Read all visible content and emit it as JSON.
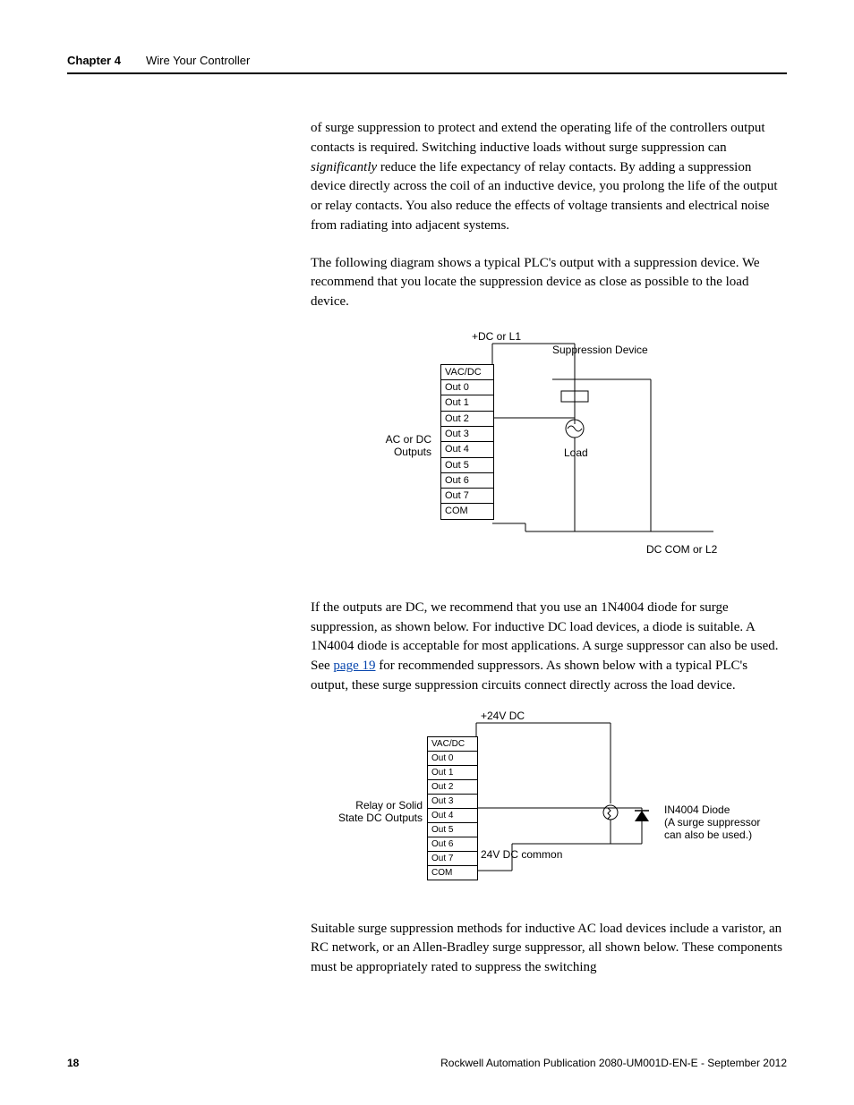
{
  "header": {
    "chapter": "Chapter 4",
    "title": "Wire Your Controller"
  },
  "p1": {
    "t1": "of surge suppression to protect and extend the operating life of the controllers output contacts is required. Switching inductive loads without surge suppression can ",
    "italic": "significantly",
    "t2": " reduce the life expectancy of relay contacts. By adding a suppression device directly across the coil of an inductive device, you prolong the life of the output or relay contacts. You also reduce the effects of voltage transients and electrical noise from radiating into adjacent systems."
  },
  "p2": "The following diagram shows a typical PLC's output with a suppression device. We recommend that you locate the suppression device as close as possible to the load device.",
  "p3": {
    "t1": "If the outputs are DC, we recommend that you use an 1N4004 diode for surge suppression, as shown below. For inductive DC load devices, a diode is suitable. A 1N4004 diode is acceptable for most applications. A surge suppressor can also be used. See ",
    "link": "page 19",
    "t2": " for recommended suppressors. As shown below with a typical PLC's output, these surge suppression circuits connect directly across the load device."
  },
  "p4": "Suitable surge suppression methods for inductive AC load devices include a varistor, an RC network, or an Allen-Bradley surge suppressor, all shown below. These components must be appropriately rated to suppress the switching",
  "diag1": {
    "top": "+DC or L1",
    "suppression": "Suppression Device",
    "left_label": "AC or DC Outputs",
    "load": "Load",
    "bottom": "DC COM or L2",
    "terms": [
      "VAC/DC",
      "Out 0",
      "Out 1",
      "Out 2",
      "Out 3",
      "Out 4",
      "Out 5",
      "Out 6",
      "Out 7",
      "COM"
    ]
  },
  "diag2": {
    "top": "+24V DC",
    "left_label": "Relay or Solid State DC Outputs",
    "common": "24V DC common",
    "diode1": "IN4004 Diode",
    "diode2": "(A surge suppressor",
    "diode3": "can also be used.)",
    "terms": [
      "VAC/DC",
      "Out 0",
      "Out 1",
      "Out 2",
      "Out 3",
      "Out 4",
      "Out 5",
      "Out 6",
      "Out 7",
      "COM"
    ]
  },
  "footer": {
    "page": "18",
    "pub": "Rockwell Automation Publication 2080-UM001D-EN-E - September 2012"
  }
}
